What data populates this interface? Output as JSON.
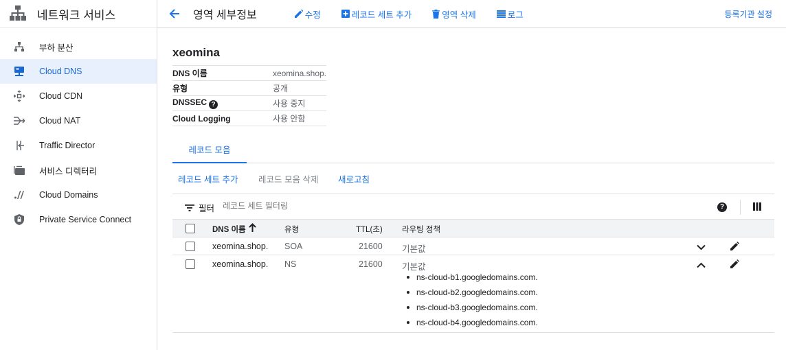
{
  "sidebar": {
    "title": "네트워크 서비스",
    "items": [
      {
        "label": "부하 분산",
        "icon": "load-balancing-icon",
        "active": false
      },
      {
        "label": "Cloud DNS",
        "icon": "dns-icon",
        "active": true
      },
      {
        "label": "Cloud CDN",
        "icon": "cdn-icon",
        "active": false
      },
      {
        "label": "Cloud NAT",
        "icon": "nat-icon",
        "active": false
      },
      {
        "label": "Traffic Director",
        "icon": "traffic-director-icon",
        "active": false
      },
      {
        "label": "서비스 디렉터리",
        "icon": "service-directory-icon",
        "active": false
      },
      {
        "label": "Cloud Domains",
        "icon": "domains-icon",
        "active": false
      },
      {
        "label": "Private Service Connect",
        "icon": "shield-icon",
        "active": false
      }
    ]
  },
  "toolbar": {
    "title": "영역 세부정보",
    "edit": "수정",
    "add_record_set": "레코드 세트 추가",
    "delete_zone": "영역 삭제",
    "logs": "로그",
    "registrar_setup": "등록기관 설정"
  },
  "zone": {
    "name": "xeomina",
    "details": [
      {
        "key": "DNS 이름",
        "value": "xeomina.shop."
      },
      {
        "key": "유형",
        "value": "공개"
      },
      {
        "key": "DNSSEC",
        "value": "사용 중지"
      },
      {
        "key": "Cloud Logging",
        "value": "사용 안함"
      }
    ]
  },
  "tabs": [
    "레코드 모음"
  ],
  "actions": {
    "add": "레코드 세트 추가",
    "delete": "레코드 모음 삭제",
    "refresh": "새로고침"
  },
  "filter": {
    "label": "필터",
    "placeholder": "레코드 세트 필터링"
  },
  "table": {
    "headers": {
      "dns_name": "DNS 이름",
      "type": "유형",
      "ttl": "TTL(초)",
      "routing": "라우팅 정책"
    },
    "rows": [
      {
        "dns_name": "xeomina.shop.",
        "type": "SOA",
        "ttl": "21600",
        "routing": "기본값",
        "expanded": false,
        "data": []
      },
      {
        "dns_name": "xeomina.shop.",
        "type": "NS",
        "ttl": "21600",
        "routing": "기본값",
        "expanded": true,
        "data": [
          "ns-cloud-b1.googledomains.com.",
          "ns-cloud-b2.googledomains.com.",
          "ns-cloud-b3.googledomains.com.",
          "ns-cloud-b4.googledomains.com."
        ]
      }
    ]
  },
  "colors": {
    "accent": "#1a73e8",
    "active_bg": "#e8f0fe",
    "border": "#dadce0"
  }
}
